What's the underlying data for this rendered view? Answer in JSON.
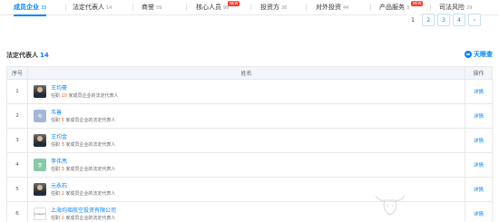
{
  "tabs": [
    {
      "label": "成员企业",
      "count": "33",
      "active": true
    },
    {
      "label": "法定代表人",
      "count": "14"
    },
    {
      "label": "商誉",
      "count": "59"
    },
    {
      "label": "核心人员",
      "count": "99",
      "badge": "NEW"
    },
    {
      "label": "投资方",
      "count": "36"
    },
    {
      "label": "对外投资",
      "count": "44"
    },
    {
      "label": "产品服务",
      "count": "3",
      "badge": "NEW"
    },
    {
      "label": "司法风险",
      "count": "29"
    }
  ],
  "pagination": {
    "pages": [
      "1",
      "2",
      "3",
      "4"
    ],
    "current": "1",
    "next": "›"
  },
  "section": {
    "title": "法定代表人",
    "count": "14",
    "brand": "天眼查"
  },
  "table": {
    "headers": {
      "index": "序号",
      "name": "姓名",
      "op": "操作"
    },
    "rows": [
      {
        "idx": "1",
        "name": "王均豪",
        "pre": "任职 ",
        "num": "10",
        "post": " 家成员企业的法定代表人",
        "op": "详情",
        "avatar": "photo",
        "avatar_text": ""
      },
      {
        "idx": "2",
        "name": "韦善",
        "pre": "任职 ",
        "num": "5",
        "post": " 家成员企业的法定代表人",
        "op": "详情",
        "avatar": "initial",
        "avatar_text": "韦",
        "avatar_color": "#a3b7d6"
      },
      {
        "idx": "3",
        "name": "王均金",
        "pre": "任职 ",
        "num": "3",
        "post": " 家成员企业的法定代表人",
        "op": "详情",
        "avatar": "photo",
        "avatar_text": ""
      },
      {
        "idx": "4",
        "name": "李伟亮",
        "pre": "任职 ",
        "num": "3",
        "post": " 家成员企业的法定代表人",
        "op": "详情",
        "avatar": "initial",
        "avatar_text": "李",
        "avatar_color": "#88c9a6"
      },
      {
        "idx": "5",
        "name": "元永石",
        "pre": "任职 ",
        "num": "2",
        "post": " 家成员企业的法定代表人",
        "op": "详情",
        "avatar": "photo",
        "avatar_text": ""
      },
      {
        "idx": "6",
        "name": "上海均瑶航空投资有限公司",
        "pre": "任职 ",
        "num": "2",
        "post": " 家成员企业的法定代表人",
        "op": "详情",
        "avatar": "logo",
        "avatar_text": "Juneyao"
      }
    ]
  }
}
